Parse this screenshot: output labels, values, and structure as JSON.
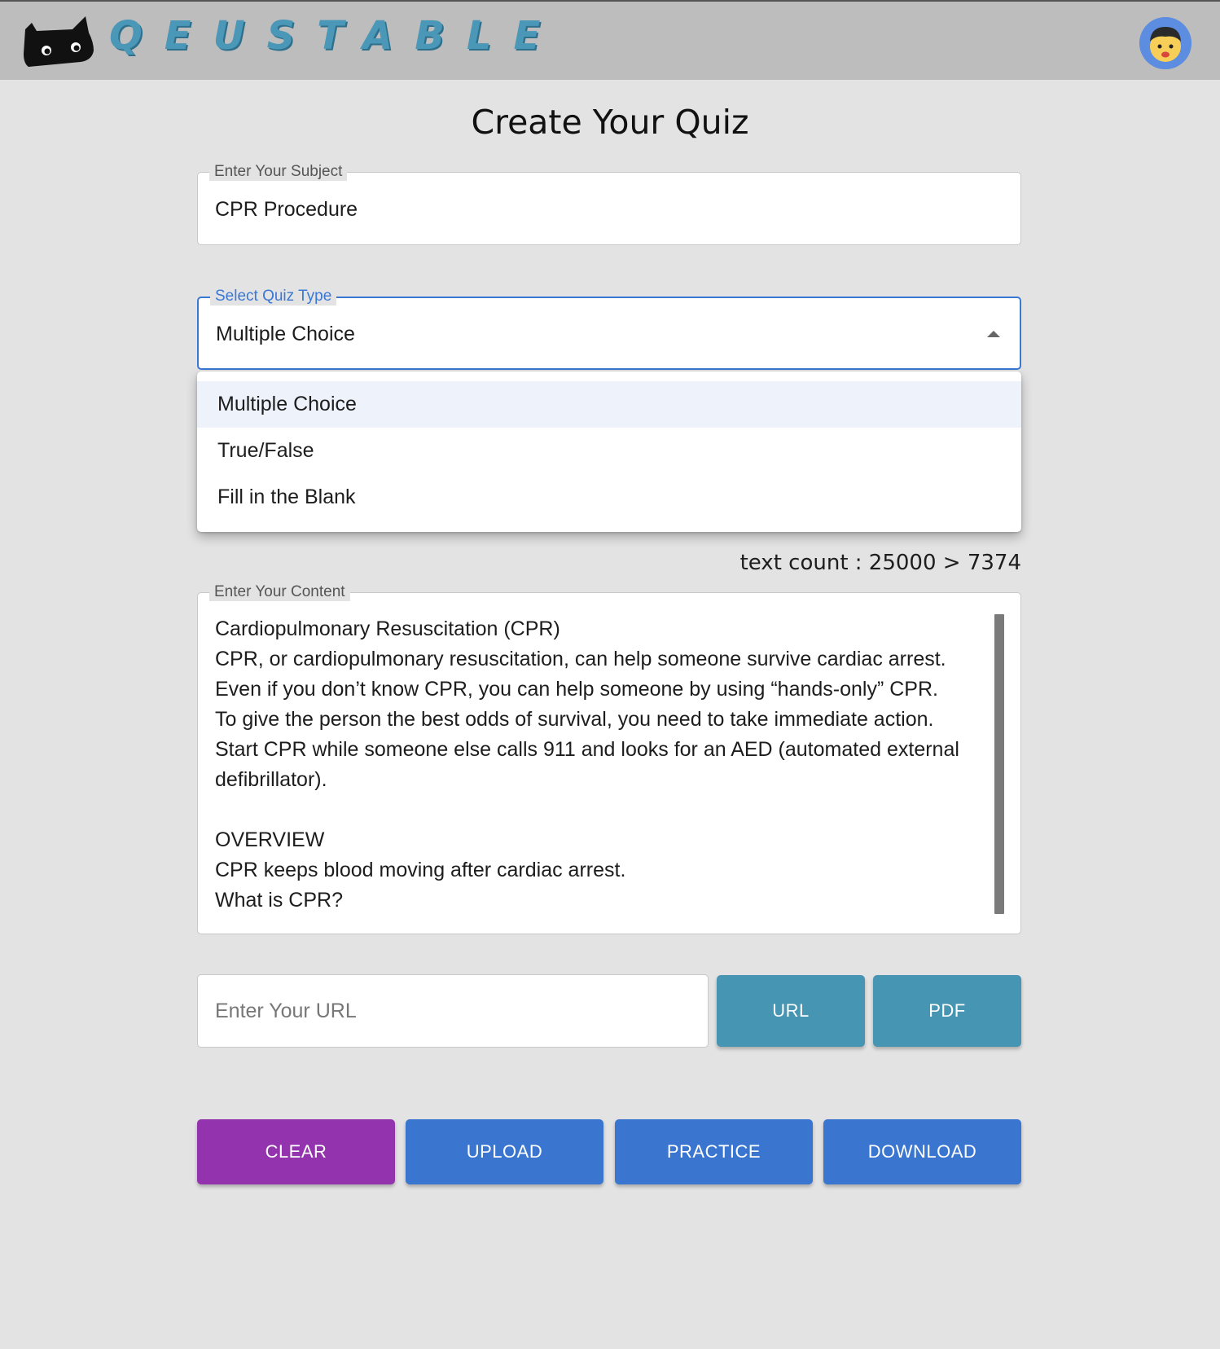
{
  "header": {
    "logo_text": "QEUSTABLE"
  },
  "page_title": "Create Your Quiz",
  "subject": {
    "legend": "Enter Your Subject",
    "value": "CPR Procedure"
  },
  "quiz_type": {
    "legend": "Select Quiz Type",
    "value": "Multiple Choice",
    "options": [
      "Multiple Choice",
      "True/False",
      "Fill in the Blank"
    ]
  },
  "text_count": "text count : 25000 > 7374",
  "content": {
    "legend": "Enter Your Content",
    "text": "Cardiopulmonary Resuscitation (CPR)\nCPR, or cardiopulmonary resuscitation, can help someone survive cardiac arrest.\nEven if you don’t know CPR, you can help someone by using “hands-only” CPR.\nTo give the person the best odds of survival, you need to take immediate action.\nStart CPR while someone else calls 911 and looks for an AED (automated external\ndefibrillator).\n\nOVERVIEW\nCPR keeps blood moving after cardiac arrest.\nWhat is CPR?"
  },
  "url_input": {
    "placeholder": "Enter Your URL"
  },
  "buttons": {
    "url": "URL",
    "pdf": "PDF",
    "clear": "CLEAR",
    "upload": "UPLOAD",
    "practice": "PRACTICE",
    "download": "DOWNLOAD"
  },
  "colors": {
    "header_bg": "#bdbdbd",
    "logo": "#4a97b8",
    "focus_blue": "#3a78d4",
    "teal_button": "#4695b3",
    "clear_button": "#9333ae",
    "primary_button": "#3a76d0"
  },
  "icons": {
    "logo": "black-cat-icon",
    "avatar": "cartoon-face-avatar",
    "dropdown": "caret-up-icon"
  }
}
